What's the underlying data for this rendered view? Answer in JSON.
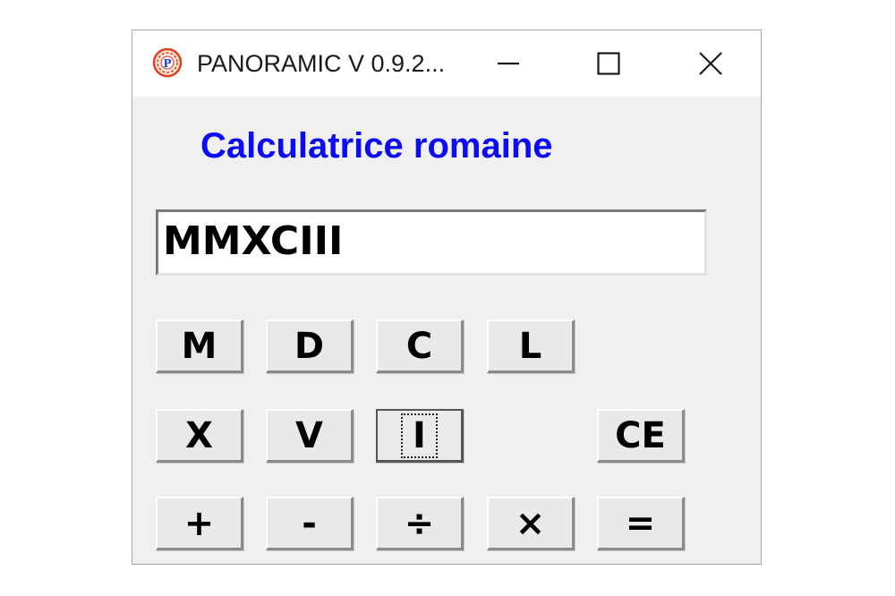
{
  "window": {
    "title": "PANORAMIC V 0.9.2...",
    "icon": "panoramic-app-icon",
    "controls": {
      "minimize_icon": "minimize-icon",
      "maximize_icon": "maximize-icon",
      "close_icon": "close-icon"
    }
  },
  "app": {
    "heading": "Calculatrice romaine",
    "heading_color": "#0c0cf4",
    "display_value": "MMXCIII"
  },
  "keypad": {
    "row1": [
      "M",
      "D",
      "C",
      "L"
    ],
    "row2": [
      "X",
      "V",
      "I",
      "CE"
    ],
    "row3": [
      "+",
      "-",
      "÷",
      "×",
      "="
    ],
    "focused_key": "I"
  }
}
